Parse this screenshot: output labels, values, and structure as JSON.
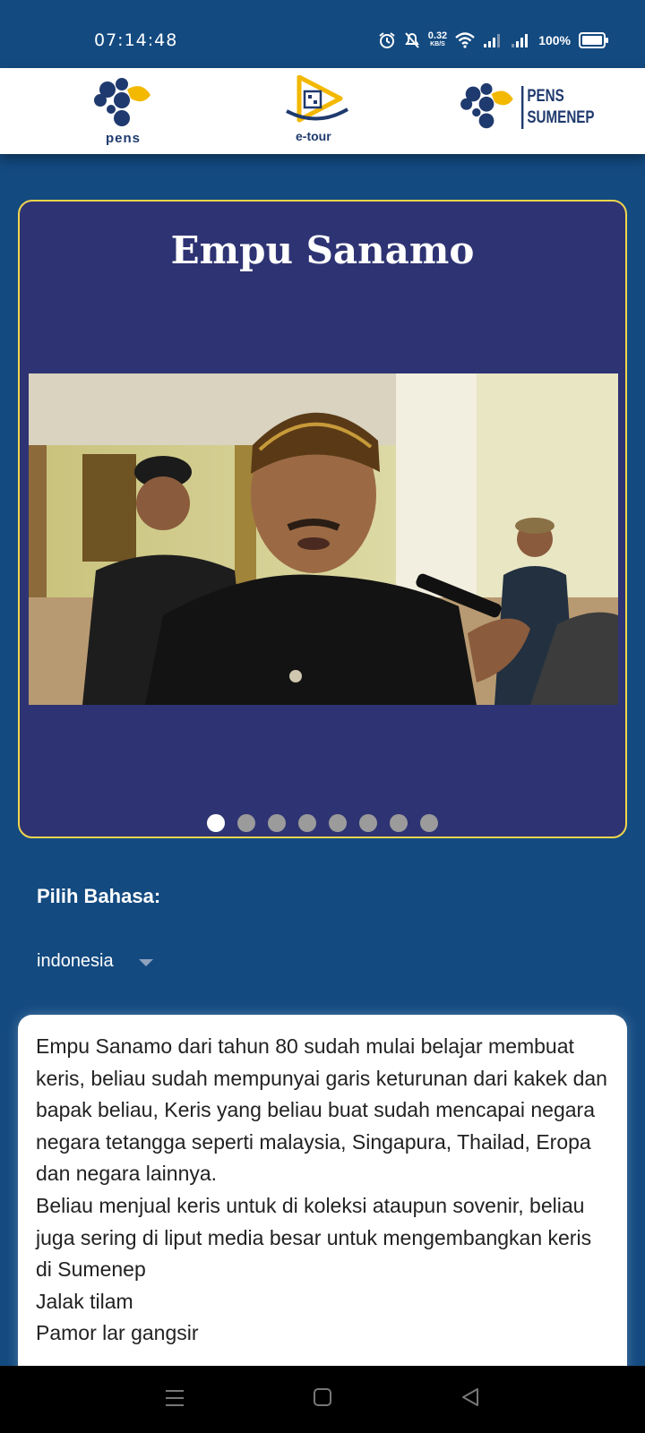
{
  "status_bar": {
    "time": "07:14:48",
    "net_speed_value": "0.32",
    "net_speed_unit": "KB/S",
    "battery": "100%"
  },
  "header": {
    "logos": [
      "pens-logo",
      "e-tour-logo",
      "pens-sumenep-logo"
    ],
    "pens_text": "pens",
    "etour_text": "e-tour",
    "sumenep_line1": "PENS",
    "sumenep_line2": "SUMENEP"
  },
  "card": {
    "title": "Empu Sanamo",
    "slides_total": 8,
    "active_slide": 1
  },
  "language": {
    "label": "Pilih Bahasa:",
    "selected": "indonesia"
  },
  "description": {
    "text": "Empu Sanamo dari tahun 80 sudah mulai belajar membuat keris, beliau sudah mempunyai garis keturunan dari kakek dan bapak beliau,  Keris yang beliau buat sudah mencapai negara negara tetangga seperti malaysia, Singapura, Thailad, Eropa dan negara lainnya.\nBeliau menjual keris untuk di koleksi ataupun sovenir, beliau juga sering di liput media besar untuk mengembangkan keris di Sumenep\nJalak tilam\nPamor lar gangsir"
  },
  "colors": {
    "background": "#134a80",
    "card": "#2e3373",
    "card_border": "#f2d54d",
    "accent_yellow": "#f3b800"
  }
}
